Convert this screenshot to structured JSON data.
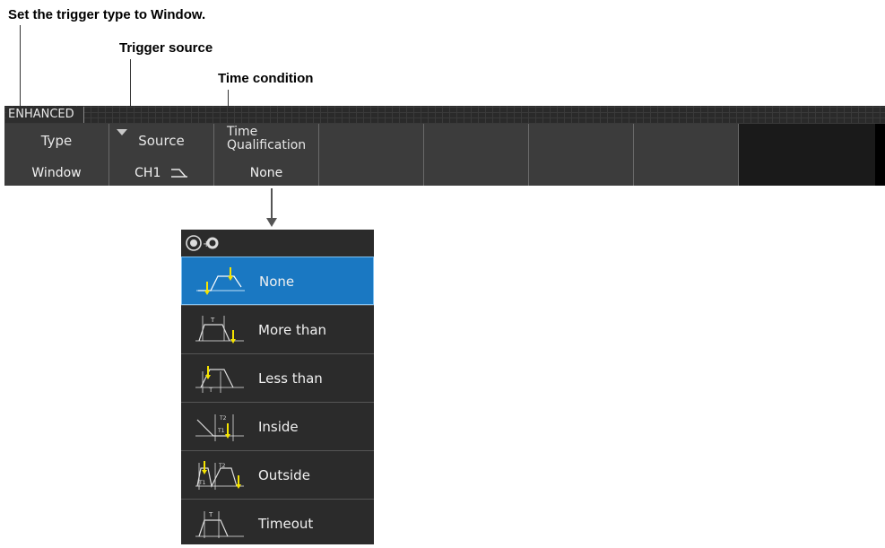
{
  "callouts": {
    "trigger_type": "Set the trigger type to Window.",
    "trigger_source": "Trigger source",
    "time_condition": "Time condition"
  },
  "menu": {
    "mode_label": "ENHANCED",
    "softkeys": [
      {
        "title": "Type",
        "value": "Window"
      },
      {
        "title": "Source",
        "value": "CH1"
      },
      {
        "title": "Time\nQualification",
        "value": "None"
      }
    ]
  },
  "popup": {
    "header_icon": "jog-push-icon",
    "options": [
      {
        "label": "None",
        "selected": true,
        "icon": "none-waveform-icon"
      },
      {
        "label": "More than",
        "selected": false,
        "icon": "more-than-waveform-icon"
      },
      {
        "label": "Less than",
        "selected": false,
        "icon": "less-than-waveform-icon"
      },
      {
        "label": "Inside",
        "selected": false,
        "icon": "inside-waveform-icon"
      },
      {
        "label": "Outside",
        "selected": false,
        "icon": "outside-waveform-icon"
      },
      {
        "label": "Timeout",
        "selected": false,
        "icon": "timeout-waveform-icon"
      }
    ]
  },
  "colors": {
    "selected_bg": "#1a78c2",
    "softkey_bg": "#3c3c3c",
    "popup_bg": "#2b2b2b",
    "marker": "#f5e400"
  }
}
